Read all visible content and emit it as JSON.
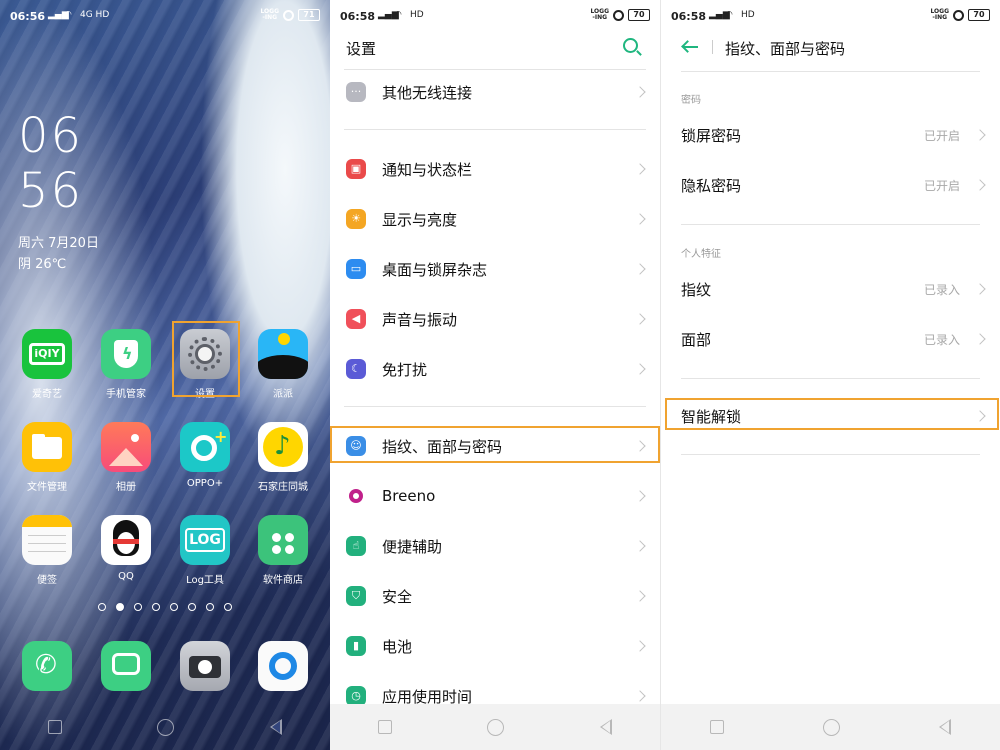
{
  "panel_home": {
    "status": {
      "time": "06:56",
      "signal": "▌▎▏▐",
      "net": "4G HD",
      "logg": "LOGG\n-ING",
      "battery": "71"
    },
    "clock": {
      "hour": "06",
      "minute": "56"
    },
    "date": "周六  7月20日",
    "weather": "阴 26℃",
    "apps": [
      {
        "label": "爱奇艺",
        "icon": "iqiyi-icon"
      },
      {
        "label": "手机管家",
        "icon": "phone-manager-icon"
      },
      {
        "label": "设置",
        "icon": "settings-gear-icon"
      },
      {
        "label": "派派",
        "icon": "paipai-icon"
      },
      {
        "label": "文件管理",
        "icon": "folder-icon"
      },
      {
        "label": "相册",
        "icon": "photos-icon"
      },
      {
        "label": "OPPO+",
        "icon": "oppo-plus-icon"
      },
      {
        "label": "石家庄同城",
        "icon": "music-note-icon"
      },
      {
        "label": "便签",
        "icon": "notes-icon"
      },
      {
        "label": "QQ",
        "icon": "qq-penguin-icon"
      },
      {
        "label": "Log工具",
        "icon": "log-tool-icon"
      },
      {
        "label": "软件商店",
        "icon": "app-store-icon"
      }
    ],
    "dock": [
      {
        "icon": "phone-icon"
      },
      {
        "icon": "message-icon"
      },
      {
        "icon": "camera-icon"
      },
      {
        "icon": "browser-icon"
      }
    ],
    "page_count": 8,
    "page_active": 1,
    "accent": "#f0a330"
  },
  "panel_settings": {
    "status": {
      "time": "06:58",
      "net": "HD",
      "logg": "LOGG\n-ING",
      "battery": "70"
    },
    "title": "设置",
    "items": [
      {
        "label": "其他无线连接",
        "icon": "more-dots-icon",
        "color": "#b7b8c0"
      },
      {
        "label": "通知与状态栏",
        "icon": "notification-icon",
        "color": "#ea4a4a"
      },
      {
        "label": "显示与亮度",
        "icon": "brightness-icon",
        "color": "#f4a623"
      },
      {
        "label": "桌面与锁屏杂志",
        "icon": "wallpaper-icon",
        "color": "#2d8cf0"
      },
      {
        "label": "声音与振动",
        "icon": "sound-icon",
        "color": "#f0505a"
      },
      {
        "label": "免打扰",
        "icon": "moon-icon",
        "color": "#5b5bd6"
      },
      {
        "label": "指纹、面部与密码",
        "icon": "fingerprint-face-icon",
        "color": "#3a8ee6"
      },
      {
        "label": "Breeno",
        "icon": "breeno-icon",
        "color": "#c0208a"
      },
      {
        "label": "便捷辅助",
        "icon": "assist-icon",
        "color": "#22b07d"
      },
      {
        "label": "安全",
        "icon": "shield-icon",
        "color": "#22b07d"
      },
      {
        "label": "电池",
        "icon": "battery-icon",
        "color": "#22b07d"
      },
      {
        "label": "应用使用时间",
        "icon": "usage-time-icon",
        "color": "#22b07d"
      }
    ],
    "search_color": "#1fb67f"
  },
  "panel_security": {
    "status": {
      "time": "06:58",
      "net": "HD",
      "logg": "LOGG\n-ING",
      "battery": "70"
    },
    "title": "指纹、面部与密码",
    "section_password": "密码",
    "lock_password": {
      "label": "锁屏密码",
      "status": "已开启"
    },
    "privacy_password": {
      "label": "隐私密码",
      "status": "已开启"
    },
    "section_bio": "个人特征",
    "fingerprint": {
      "label": "指纹",
      "status": "已录入"
    },
    "face": {
      "label": "面部",
      "status": "已录入"
    },
    "smart_unlock": {
      "label": "智能解锁"
    }
  }
}
